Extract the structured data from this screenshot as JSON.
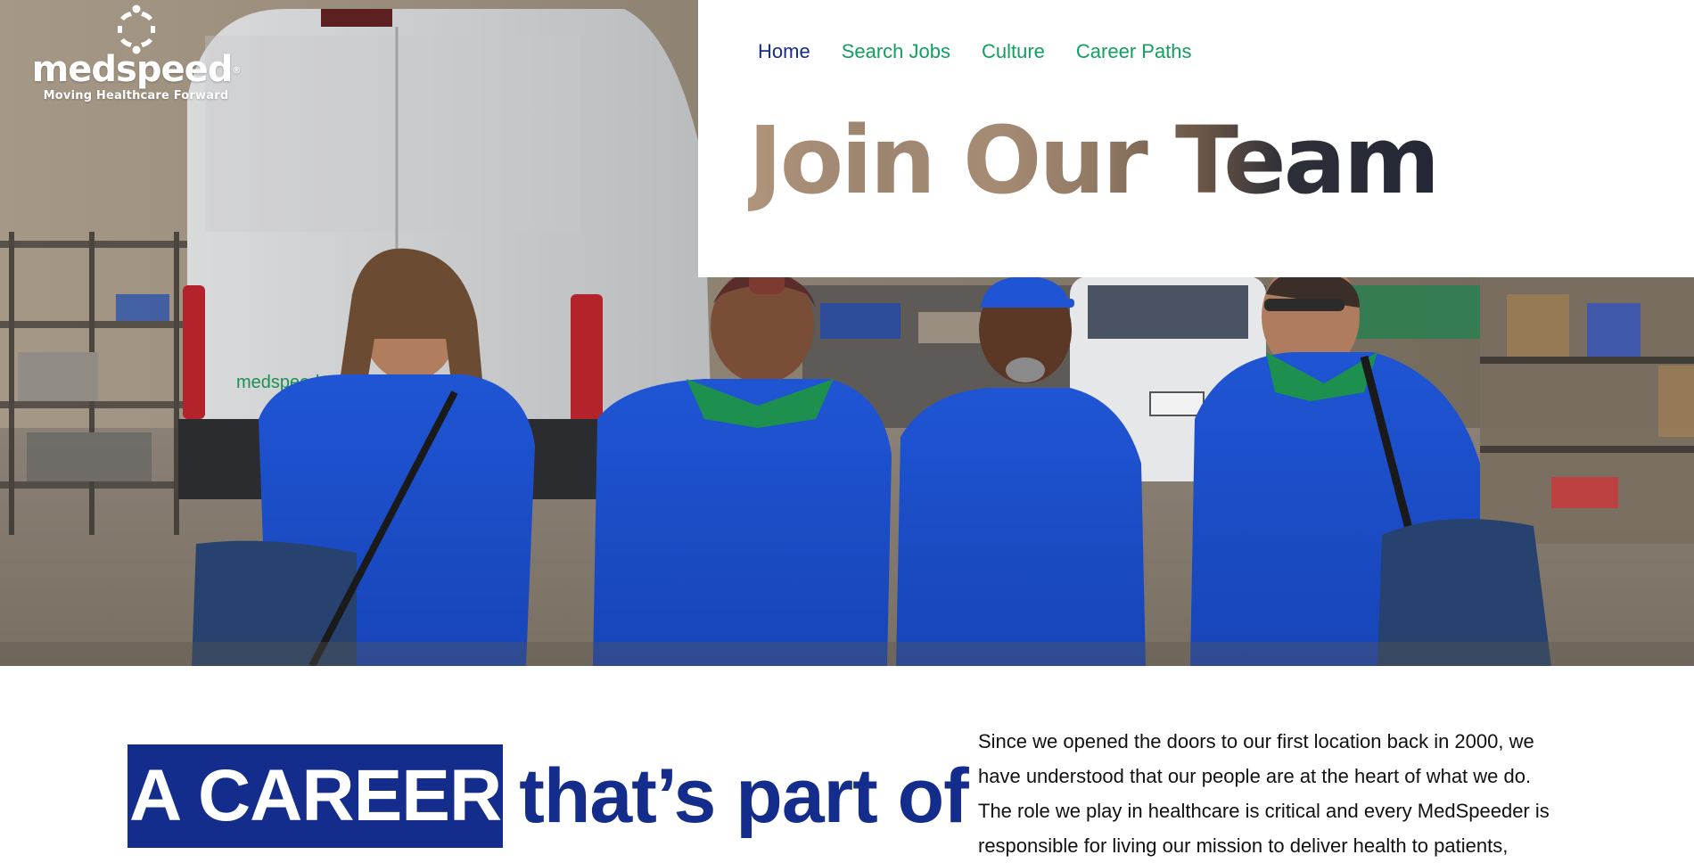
{
  "brand": {
    "name": "medspeed",
    "registered": "®",
    "tagline": "Moving Healthcare Forward"
  },
  "nav": {
    "items": [
      {
        "label": "Home",
        "active": true
      },
      {
        "label": "Search Jobs",
        "active": false
      },
      {
        "label": "Culture",
        "active": false
      },
      {
        "label": "Career Paths",
        "active": false
      }
    ]
  },
  "hero": {
    "title": "Join Our Team",
    "photo_icon": "team-photo-image"
  },
  "intro": {
    "highlight": "A CAREER",
    "heading_rest": "that’s part of",
    "paragraph": "Since we opened the doors to our first location back in 2000, we have understood that our people are at the heart of what we do. The role we play in healthcare is critical and every MedSpeeder is responsible for living our mission to deliver health to patients,"
  },
  "colors": {
    "brand_blue": "#142d8c",
    "brand_green": "#12a05c",
    "text": "#111111",
    "white": "#ffffff"
  }
}
